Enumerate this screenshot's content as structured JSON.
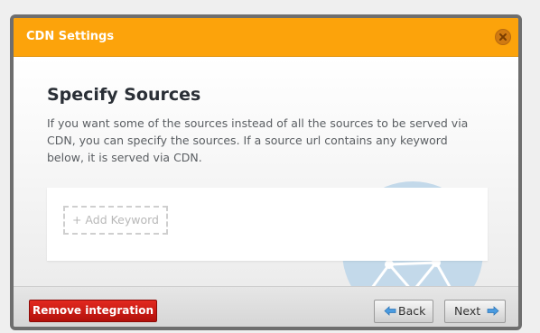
{
  "dialog": {
    "title": "CDN Settings",
    "close_icon": "close-icon"
  },
  "content": {
    "heading": "Specify Sources",
    "description": "If you want some of the sources instead of all the sources to be served via CDN, you can specify the sources. If a source url contains any keyword below, it is served via CDN.",
    "add_keyword_placeholder": "+ Add Keyword"
  },
  "footer": {
    "remove_label": "Remove integration",
    "back_label": "Back",
    "next_label": "Next"
  },
  "colors": {
    "titlebar": "#fca30b",
    "remove_button": "#c8170f",
    "arrow": "#4a9be0"
  }
}
